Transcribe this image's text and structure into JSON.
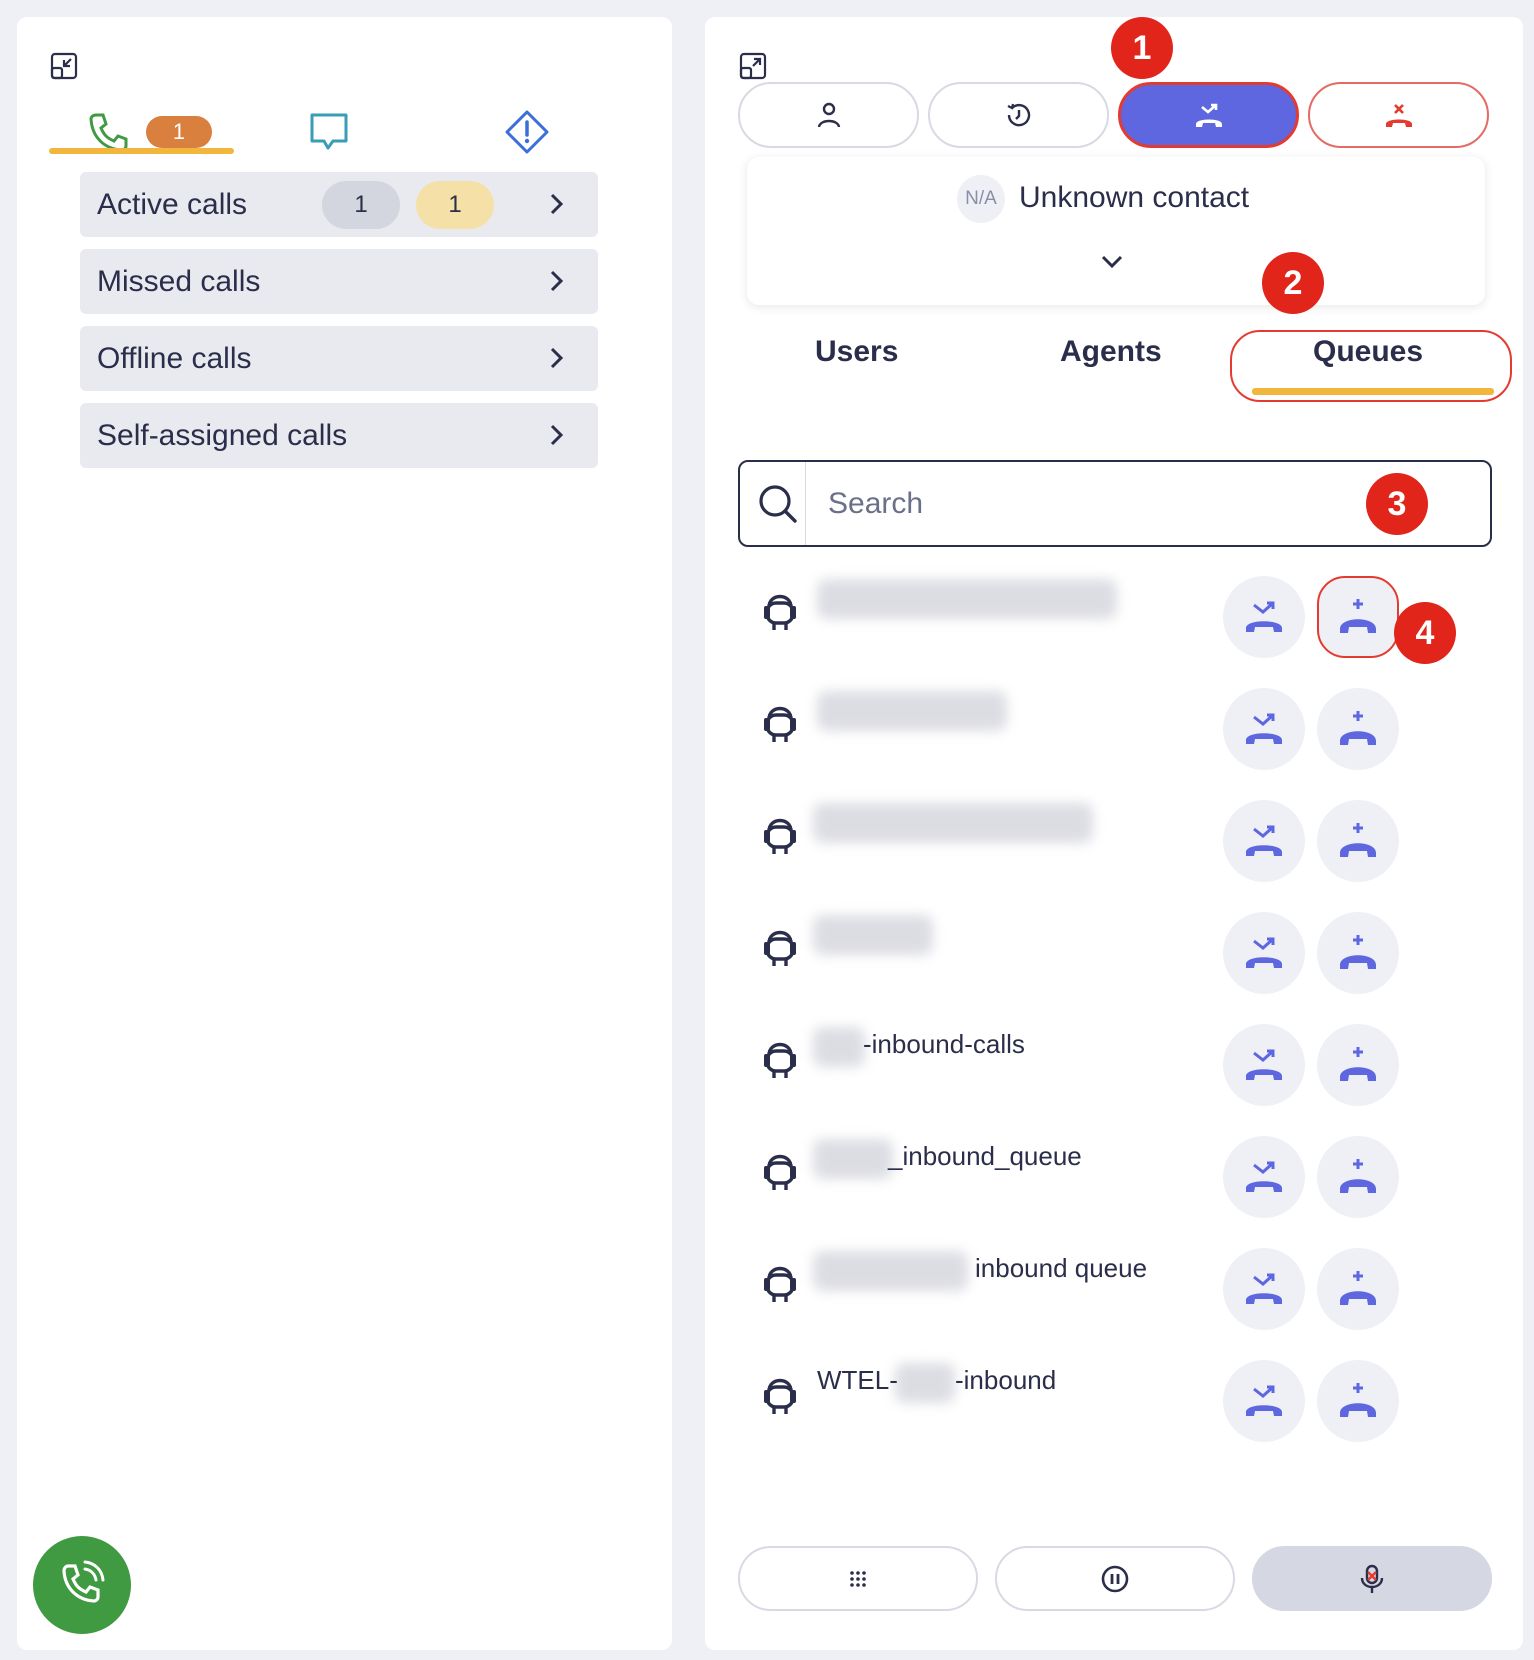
{
  "left_panel": {
    "phone_tab_badge": "1",
    "menu": [
      {
        "label": "Active calls",
        "count_a": "1",
        "count_b": "1"
      },
      {
        "label": "Missed calls"
      },
      {
        "label": "Offline calls"
      },
      {
        "label": "Self-assigned calls"
      }
    ]
  },
  "right_panel": {
    "contact": {
      "initials": "N/A",
      "name": "Unknown contact"
    },
    "tabs": {
      "users": "Users",
      "agents": "Agents",
      "queues": "Queues"
    },
    "search": {
      "placeholder": "Search"
    },
    "queues": [
      {
        "name": ""
      },
      {
        "name": ""
      },
      {
        "name": ""
      },
      {
        "name": ""
      },
      {
        "name": "-inbound-calls"
      },
      {
        "name": "_inbound_queue"
      },
      {
        "name": "inbound queue"
      },
      {
        "name_prefix": "WTEL-",
        "name": "-inbound"
      }
    ],
    "annotations": [
      "1",
      "2",
      "3",
      "4"
    ]
  },
  "colors": {
    "accent": "#5e66e0",
    "highlight": "#f2b63c",
    "annotation": "#e1251b",
    "green": "#3f9a41",
    "badge_orange": "#d9803f"
  }
}
